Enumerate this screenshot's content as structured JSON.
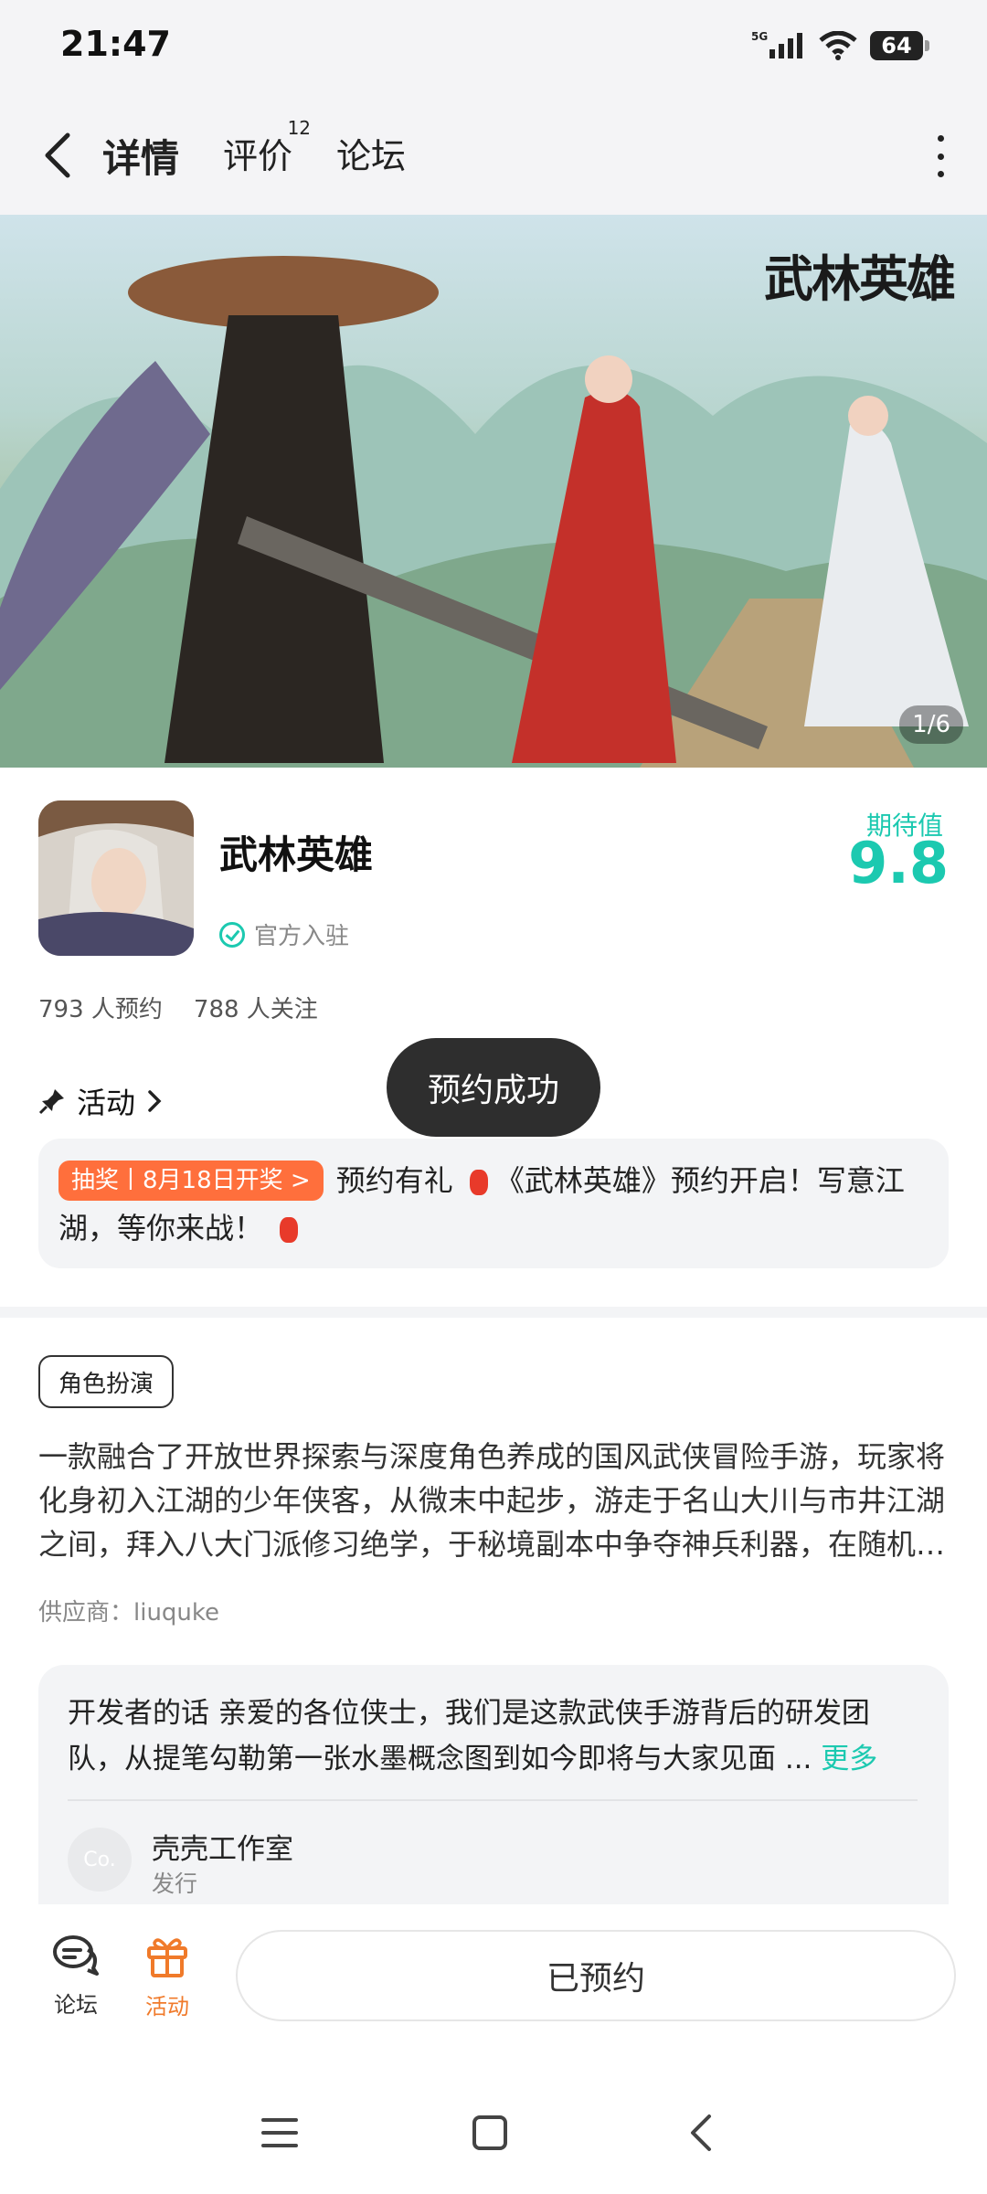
{
  "status_bar": {
    "time": "21:47",
    "network": "5G",
    "battery": "64"
  },
  "header": {
    "tabs": [
      {
        "label": "详情",
        "active": true
      },
      {
        "label": "评价",
        "badge": "12"
      },
      {
        "label": "论坛"
      }
    ]
  },
  "banner": {
    "title": "武林英雄",
    "counter": "1/6"
  },
  "app": {
    "name": "武林英雄",
    "official_label": "官方入驻",
    "expect_label": "期待值",
    "expect_value": "9.8",
    "reservations": "793 人预约",
    "followers": "788 人关注"
  },
  "activity": {
    "label": "活动",
    "tag": "抽奖丨8月18日开奖 >",
    "text_1": "预约有礼",
    "text_2": "《武林英雄》预约开启！写意江湖，等你来战！"
  },
  "toast": "预约成功",
  "genre_tag": "角色扮演",
  "description": "一款融合了开放世界探索与深度角色养成的国风武侠冒险手游，玩家将化身初入江湖的少年侠客，从微末中起步，游走于名山大川与市井江湖之间，拜入八大门派修习绝学，于秘境副本中争夺神兵利器，在随机…",
  "supplier": "供应商：liuquke",
  "developer": {
    "text": "开发者的话  亲爱的各位侠士，我们是这款武侠手游背后的研发团队，从提笔勾勒第一张水墨概念图到如今即将与大家见面 ...",
    "more": "更多",
    "avatar_text": "Co.",
    "name": "壳壳工作室",
    "role": "发行"
  },
  "bottom_bar": {
    "forum": "论坛",
    "activity": "活动",
    "reserve_button": "已预约"
  },
  "colors": {
    "accent": "#1cc9b0",
    "orange": "#f07a2a",
    "toast_bg": "#2e2e2e"
  }
}
